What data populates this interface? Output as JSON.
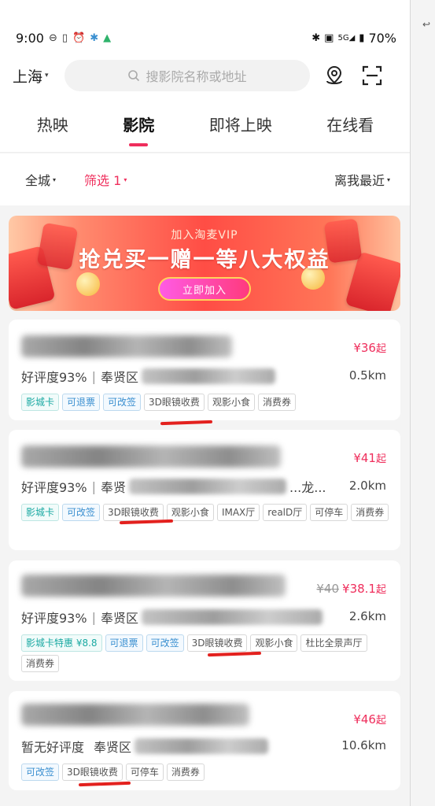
{
  "status_bar": {
    "time": "9:00",
    "left_icons": [
      "minus-circle-icon",
      "vibrate-icon",
      "alarm-icon",
      "bluetooth-small-icon",
      "app-notification-icon"
    ],
    "right_icons": [
      "bluetooth-icon",
      "nfc-icon",
      "5g-signal-icon",
      "battery-icon"
    ],
    "network_label": "5G",
    "battery": "70%"
  },
  "header": {
    "city": "上海",
    "search_placeholder": "搜影院名称或地址",
    "icons": [
      "location-pin-icon",
      "scan-icon"
    ]
  },
  "tabs": [
    {
      "label": "热映",
      "active": false
    },
    {
      "label": "影院",
      "active": true
    },
    {
      "label": "即将上映",
      "active": false
    },
    {
      "label": "在线看",
      "active": false
    }
  ],
  "filters": {
    "area": "全城",
    "screen": "筛选 1",
    "sort": "离我最近"
  },
  "banner": {
    "subtitle": "加入淘麦VIP",
    "title": "抢兑买一赠一等八大权益",
    "button": "立即加入"
  },
  "cinemas": [
    {
      "price": "¥36",
      "price_suffix": "起",
      "original_price": "",
      "rating": "好评度93%",
      "district": "奉贤区",
      "address_tail": "",
      "distance": "0.5km",
      "tags_row1": [
        {
          "text": "影城卡",
          "style": "teal"
        },
        {
          "text": "可退票",
          "style": "blue"
        },
        {
          "text": "可改签",
          "style": "blue"
        },
        {
          "text": "3D眼镜收费",
          "style": "plain"
        },
        {
          "text": "观影小食",
          "style": "plain"
        },
        {
          "text": "消费券",
          "style": "plain"
        }
      ],
      "tags_row2": []
    },
    {
      "price": "¥41",
      "price_suffix": "起",
      "original_price": "",
      "rating": "好评度93%",
      "district": "奉贤",
      "address_tail": "...龙...",
      "distance": "2.0km",
      "tags_row1": [
        {
          "text": "影城卡",
          "style": "teal"
        },
        {
          "text": "可改签",
          "style": "blue"
        },
        {
          "text": "3D眼镜收费",
          "style": "plain"
        },
        {
          "text": "观影小食",
          "style": "plain"
        },
        {
          "text": "IMAX厅",
          "style": "plain"
        },
        {
          "text": "realD厅",
          "style": "plain"
        }
      ],
      "tags_row2": [
        {
          "text": "可停车",
          "style": "plain"
        },
        {
          "text": "消费券",
          "style": "plain"
        }
      ]
    },
    {
      "price": "¥38.1",
      "price_suffix": "起",
      "original_price": "¥40",
      "rating": "好评度93%",
      "district": "奉贤区",
      "address_tail": "",
      "distance": "2.6km",
      "tags_row1": [
        {
          "text": "影城卡特惠 ¥8.8",
          "style": "teal"
        },
        {
          "text": "可退票",
          "style": "blue"
        },
        {
          "text": "可改签",
          "style": "blue"
        },
        {
          "text": "3D眼镜收费",
          "style": "plain"
        },
        {
          "text": "观影小食",
          "style": "plain"
        }
      ],
      "tags_row2": [
        {
          "text": "杜比全景声厅",
          "style": "plain"
        },
        {
          "text": "消费券",
          "style": "plain"
        }
      ]
    },
    {
      "price": "¥46",
      "price_suffix": "起",
      "original_price": "",
      "rating": "暂无好评度",
      "district": "奉贤区",
      "address_tail": "",
      "distance": "10.6km",
      "tags_row1": [
        {
          "text": "可改签",
          "style": "blue"
        },
        {
          "text": "3D眼镜收费",
          "style": "plain"
        },
        {
          "text": "可停车",
          "style": "plain"
        },
        {
          "text": "消费券",
          "style": "plain"
        }
      ],
      "tags_row2": []
    }
  ],
  "colors": {
    "accent": "#ef2e5c",
    "annotation_mark": "#e3211e",
    "tag_blue": "#3a8fd0",
    "tag_teal": "#1aa9a2"
  }
}
